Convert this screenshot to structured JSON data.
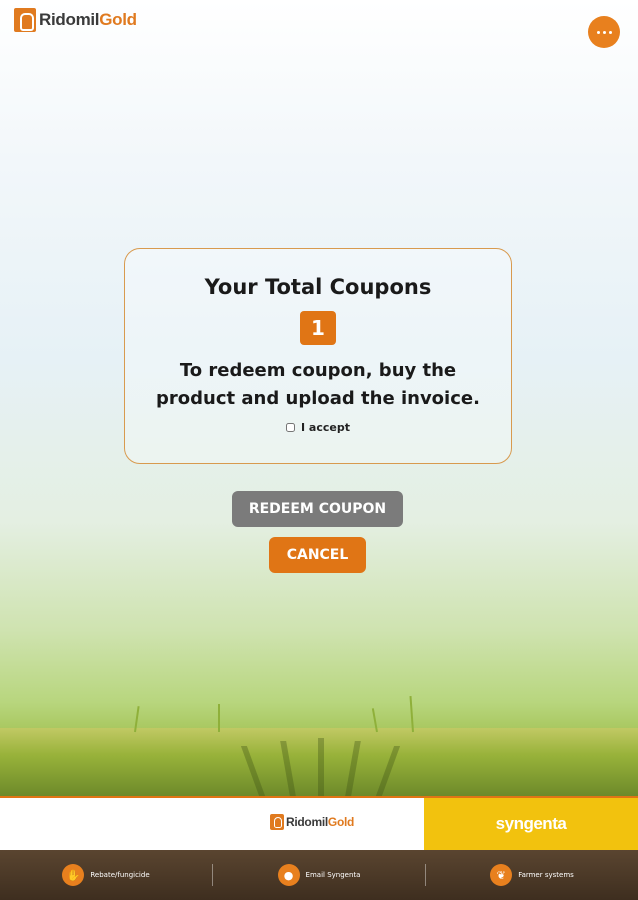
{
  "header": {
    "logo_part1": "Ridomil",
    "logo_part2": "Gold",
    "menu_icon": "more-dots-icon"
  },
  "card": {
    "title": "Your Total Coupons",
    "count": "1",
    "message_line1": "To redeem coupon, buy the",
    "message_line2": "product and upload the invoice.",
    "accept_label": "I accept"
  },
  "buttons": {
    "redeem": "REDEEM COUPON",
    "cancel": "CANCEL"
  },
  "footer": {
    "logo_part1": "Ridomil",
    "logo_part2": "Gold",
    "partner": "syngenta",
    "nav": [
      {
        "label": "Rebate/fungicide",
        "icon": "hand-icon"
      },
      {
        "label": "Email Syngenta",
        "icon": "coin-icon"
      },
      {
        "label": "Farmer systems",
        "icon": "leaf-icon"
      }
    ]
  },
  "colors": {
    "accent": "#e07515",
    "grey_button": "#7b7b7b",
    "partner_yellow": "#f2c20e"
  }
}
